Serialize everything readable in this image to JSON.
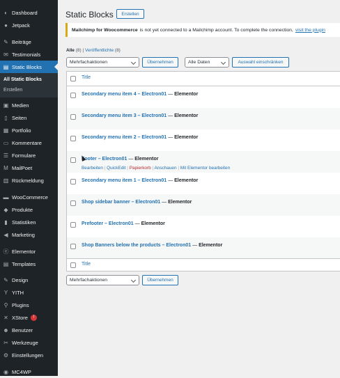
{
  "sidebar": {
    "items": [
      {
        "label": "Dashboard",
        "icon": "dashboard-icon",
        "glyph": "◐"
      },
      {
        "label": "Jetpack",
        "icon": "jetpack-icon",
        "glyph": "●"
      },
      {
        "label": "Beiträge",
        "icon": "pushpin-icon",
        "glyph": "✎"
      },
      {
        "label": "Testimonials",
        "icon": "testimonials-icon",
        "glyph": "✉"
      },
      {
        "label": "Static Blocks",
        "icon": "blocks-icon",
        "glyph": "▤"
      },
      {
        "label": "Medien",
        "icon": "media-icon",
        "glyph": "▣"
      },
      {
        "label": "Seiten",
        "icon": "pages-icon",
        "glyph": "▯"
      },
      {
        "label": "Portfolio",
        "icon": "portfolio-icon",
        "glyph": "▦"
      },
      {
        "label": "Kommentare",
        "icon": "comments-icon",
        "glyph": "▭"
      },
      {
        "label": "Formulare",
        "icon": "forms-icon",
        "glyph": "☰"
      },
      {
        "label": "MailPoet",
        "icon": "mailpoet-icon",
        "glyph": "M"
      },
      {
        "label": "Rückmeldung",
        "icon": "feedback-icon",
        "glyph": "▥"
      },
      {
        "label": "WooCommerce",
        "icon": "woocommerce-icon",
        "glyph": "▬"
      },
      {
        "label": "Produkte",
        "icon": "products-icon",
        "glyph": "◆"
      },
      {
        "label": "Statistiken",
        "icon": "statistics-icon",
        "glyph": "▮"
      },
      {
        "label": "Marketing",
        "icon": "marketing-icon",
        "glyph": "◀"
      },
      {
        "label": "Elementor",
        "icon": "elementor-icon",
        "glyph": "ⓔ"
      },
      {
        "label": "Templates",
        "icon": "templates-icon",
        "glyph": "▤"
      },
      {
        "label": "Design",
        "icon": "design-icon",
        "glyph": "✎"
      },
      {
        "label": "YITH",
        "icon": "yith-icon",
        "glyph": "Y"
      },
      {
        "label": "Plugins",
        "icon": "plugins-icon",
        "glyph": "⚲"
      },
      {
        "label": "XStore",
        "icon": "xstore-icon",
        "glyph": "✕"
      },
      {
        "label": "Benutzer",
        "icon": "users-icon",
        "glyph": "☻"
      },
      {
        "label": "Werkzeuge",
        "icon": "tools-icon",
        "glyph": "✂"
      },
      {
        "label": "Einstellungen",
        "icon": "settings-icon",
        "glyph": "⚙"
      },
      {
        "label": "MC4WP",
        "icon": "mc4wp-icon",
        "glyph": "◉"
      }
    ],
    "submenu": {
      "all": "All Static Blocks",
      "create": "Erstellen"
    },
    "xstore_badge": "!"
  },
  "header": {
    "title": "Static Blocks",
    "create_button": "Erstellen"
  },
  "notice": {
    "plugin": "Mailchimp for Woocommerce",
    "text": "is not yet connected to a Mailchimp account. To complete the connection,",
    "link": "visit the plugin"
  },
  "views": {
    "all": "Alle",
    "all_count": "(8)",
    "sep": "|",
    "published": "Veröffentlichte",
    "published_count": "(8)"
  },
  "bulk_top": {
    "select": "Mehrfachaktionen",
    "apply": "Übernehmen",
    "dates": "Alle Daten",
    "filter": "Auswahl einschränken"
  },
  "bulk_bottom": {
    "select": "Mehrfachaktionen",
    "apply": "Übernehmen"
  },
  "table": {
    "header_title": "Title",
    "footer_title": "Title",
    "rows": [
      {
        "title": "Secondary menu item 4 – Electron01",
        "dash": "—",
        "state": "Elementor"
      },
      {
        "title": "Secondary menu item 3 – Electron01",
        "dash": "—",
        "state": "Elementor"
      },
      {
        "title": "Secondary menu item 2 – Electron01",
        "dash": "—",
        "state": "Elementor"
      },
      {
        "title": "Footer – Electron01",
        "dash": "—",
        "state": "Elementor"
      },
      {
        "title": "Secondary menu item 1 – Electron01",
        "dash": "—",
        "state": "Elementor"
      },
      {
        "title": "Shop sidebar banner – Electron01",
        "dash": "—",
        "state": "Elementor"
      },
      {
        "title": "Prefooter – Electron01",
        "dash": "—",
        "state": "Elementor"
      },
      {
        "title": "Shop Banners below the products – Electron01",
        "dash": "—",
        "state": "Elementor"
      }
    ],
    "row_actions": {
      "edit": "Bearbeiten",
      "quickedit": "QuickEdit",
      "trash": "Papierkorb",
      "view": "Anschauen",
      "elementor": "Mit Elementor bearbeiten",
      "sep": "|"
    }
  },
  "colors": {
    "sidebar": "#1d2327",
    "accent": "#2271b1",
    "warning": "#dba617",
    "danger": "#b32d2e"
  }
}
